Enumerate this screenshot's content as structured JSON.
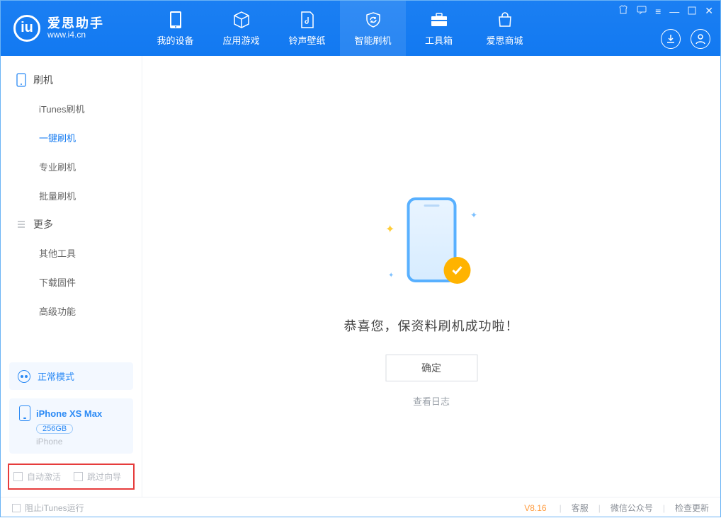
{
  "app": {
    "name_cn": "爱思助手",
    "name_en": "www.i4.cn"
  },
  "topnav": [
    {
      "label": "我的设备"
    },
    {
      "label": "应用游戏"
    },
    {
      "label": "铃声壁纸"
    },
    {
      "label": "智能刷机"
    },
    {
      "label": "工具箱"
    },
    {
      "label": "爱思商城"
    }
  ],
  "sidebar": {
    "group1_title": "刷机",
    "group1_items": [
      "iTunes刷机",
      "一键刷机",
      "专业刷机",
      "批量刷机"
    ],
    "group2_title": "更多",
    "group2_items": [
      "其他工具",
      "下载固件",
      "高级功能"
    ]
  },
  "mode_label": "正常模式",
  "device": {
    "name": "iPhone XS Max",
    "capacity": "256GB",
    "subtype": "iPhone"
  },
  "options": {
    "auto_activate": "自动激活",
    "skip_guide": "跳过向导"
  },
  "main": {
    "success_text": "恭喜您，保资料刷机成功啦！",
    "ok_label": "确定",
    "log_link": "查看日志"
  },
  "footer": {
    "block_itunes": "阻止iTunes运行",
    "version": "V8.16",
    "link_support": "客服",
    "link_wechat": "微信公众号",
    "link_update": "检查更新"
  }
}
